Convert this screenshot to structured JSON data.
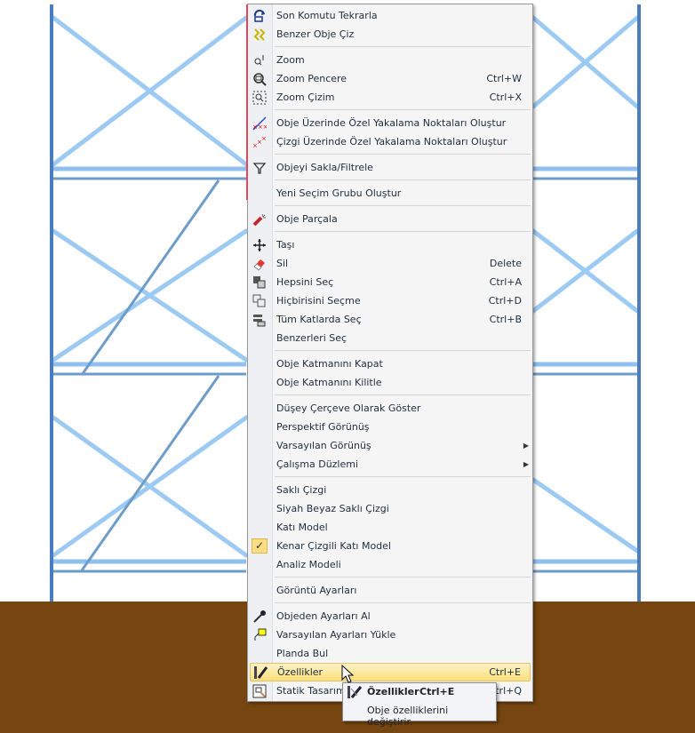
{
  "menu": {
    "items": [
      {
        "label": "Son Komutu Tekrarla",
        "icon": "repeat-command-icon"
      },
      {
        "label": "Benzer Obje Çiz",
        "icon": "draw-similar-icon"
      },
      {
        "sep": true
      },
      {
        "label": "Zoom",
        "icon": "zoom-icon"
      },
      {
        "label": "Zoom Pencere",
        "shortcut": "Ctrl+W",
        "icon": "zoom-window-icon"
      },
      {
        "label": "Zoom Çizim",
        "shortcut": "Ctrl+X",
        "icon": "zoom-extents-icon"
      },
      {
        "sep": true
      },
      {
        "label": "Obje Üzerinde Özel Yakalama Noktaları Oluştur",
        "icon": "object-snap-points-icon"
      },
      {
        "label": "Çizgi Üzerinde Özel Yakalama Noktaları Oluştur",
        "icon": "line-snap-points-icon"
      },
      {
        "sep": true
      },
      {
        "label": "Objeyi Sakla/Filtrele",
        "icon": "filter-icon"
      },
      {
        "sep": true
      },
      {
        "label": "Yeni Seçim Grubu Oluştur"
      },
      {
        "sep": true
      },
      {
        "label": "Obje Parçala",
        "icon": "explode-icon"
      },
      {
        "sep": true
      },
      {
        "label": "Taşı",
        "icon": "move-icon"
      },
      {
        "label": "Sil",
        "shortcut": "Delete",
        "icon": "eraser-icon"
      },
      {
        "label": "Hepsini Seç",
        "shortcut": "Ctrl+A",
        "icon": "select-all-icon"
      },
      {
        "label": "Hiçbirisini Seçme",
        "shortcut": "Ctrl+D",
        "icon": "select-none-icon"
      },
      {
        "label": "Tüm Katlarda Seç",
        "shortcut": "Ctrl+B",
        "icon": "select-all-floors-icon"
      },
      {
        "label": "Benzerleri Seç"
      },
      {
        "sep": true
      },
      {
        "label": "Obje Katmanını Kapat"
      },
      {
        "label": "Obje Katmanını Kilitle"
      },
      {
        "sep": true
      },
      {
        "label": "Düşey Çerçeve Olarak Göster"
      },
      {
        "label": "Perspektif Görünüş"
      },
      {
        "label": "Varsayılan Görünüş",
        "submenu": true
      },
      {
        "label": "Çalışma Düzlemi",
        "submenu": true
      },
      {
        "sep": true
      },
      {
        "label": "Saklı Çizgi"
      },
      {
        "label": "Siyah Beyaz Saklı Çizgi"
      },
      {
        "label": "Katı Model"
      },
      {
        "label": "Kenar Çizgili Katı Model",
        "checked": true
      },
      {
        "label": "Analiz Modeli"
      },
      {
        "sep": true
      },
      {
        "label": "Görüntü Ayarları"
      },
      {
        "sep": true
      },
      {
        "label": "Objeden Ayarları Al",
        "icon": "eyedropper-icon"
      },
      {
        "label": "Varsayılan Ayarları Yükle",
        "icon": "load-defaults-icon"
      },
      {
        "label": "Planda Bul"
      },
      {
        "label": "Özellikler",
        "shortcut": "Ctrl+E",
        "icon": "properties-icon",
        "highlighted": true
      },
      {
        "label": "Statik Tasarım",
        "shortcut": "Ctrl+Q",
        "icon": "static-design-icon"
      }
    ]
  },
  "tooltip": {
    "title": "Özellikler",
    "shortcut": "Ctrl+E",
    "description": "Obje özelliklerini değiştirir."
  },
  "colors": {
    "accent": "#fbdf7a",
    "ground": "#774610",
    "frame": "#4a7cc0",
    "brace": "#8fc0ef"
  }
}
